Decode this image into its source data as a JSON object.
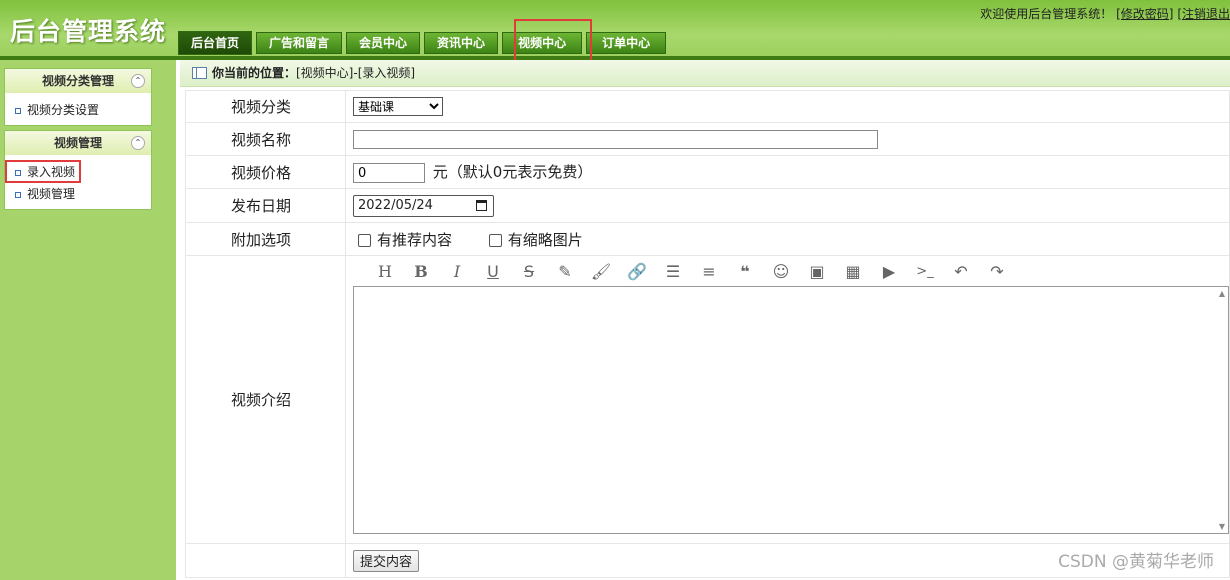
{
  "header": {
    "logo": "后台管理系统",
    "welcome_text": "欢迎使用后台管理系统！",
    "change_password": "[修改密码]",
    "logout": "[注销退出"
  },
  "nav": {
    "tabs": [
      "后台首页",
      "广告和留言",
      "会员中心",
      "资讯中心",
      "视频中心",
      "订单中心"
    ],
    "active": "后台首页",
    "highlighted": "视频中心"
  },
  "sidebar": {
    "group1": {
      "title": "视频分类管理",
      "items": [
        "视频分类设置"
      ]
    },
    "group2": {
      "title": "视频管理",
      "items": [
        "录入视频",
        "视频管理"
      ]
    }
  },
  "breadcrumb": {
    "label": "你当前的位置：",
    "path": "[视频中心]-[录入视频]"
  },
  "form": {
    "category": {
      "label": "视频分类",
      "value": "基础课"
    },
    "name": {
      "label": "视频名称",
      "value": ""
    },
    "price": {
      "label": "视频价格",
      "value": "0",
      "hint": "元（默认0元表示免费）"
    },
    "date": {
      "label": "发布日期",
      "value": "2022/05/24"
    },
    "options": {
      "label": "附加选项",
      "recommend": "有推荐内容",
      "thumbnail": "有缩略图片"
    },
    "intro": {
      "label": "视频介绍"
    },
    "submit": "提交内容"
  },
  "editor_toolbar": [
    "heading-icon",
    "bold-icon",
    "italic-icon",
    "underline-icon",
    "strikethrough-icon",
    "highlight-icon",
    "brush-icon",
    "link-icon",
    "list-icon",
    "align-icon",
    "quote-icon",
    "emoji-icon",
    "image-icon",
    "table-icon",
    "video-icon",
    "code-icon",
    "undo-icon",
    "redo-icon"
  ],
  "watermark": "CSDN @黄菊华老师",
  "colors": {
    "nav_green": "#3d8315",
    "highlight_red": "#e23b3b",
    "sidebar_bg": "#a6d36a"
  }
}
